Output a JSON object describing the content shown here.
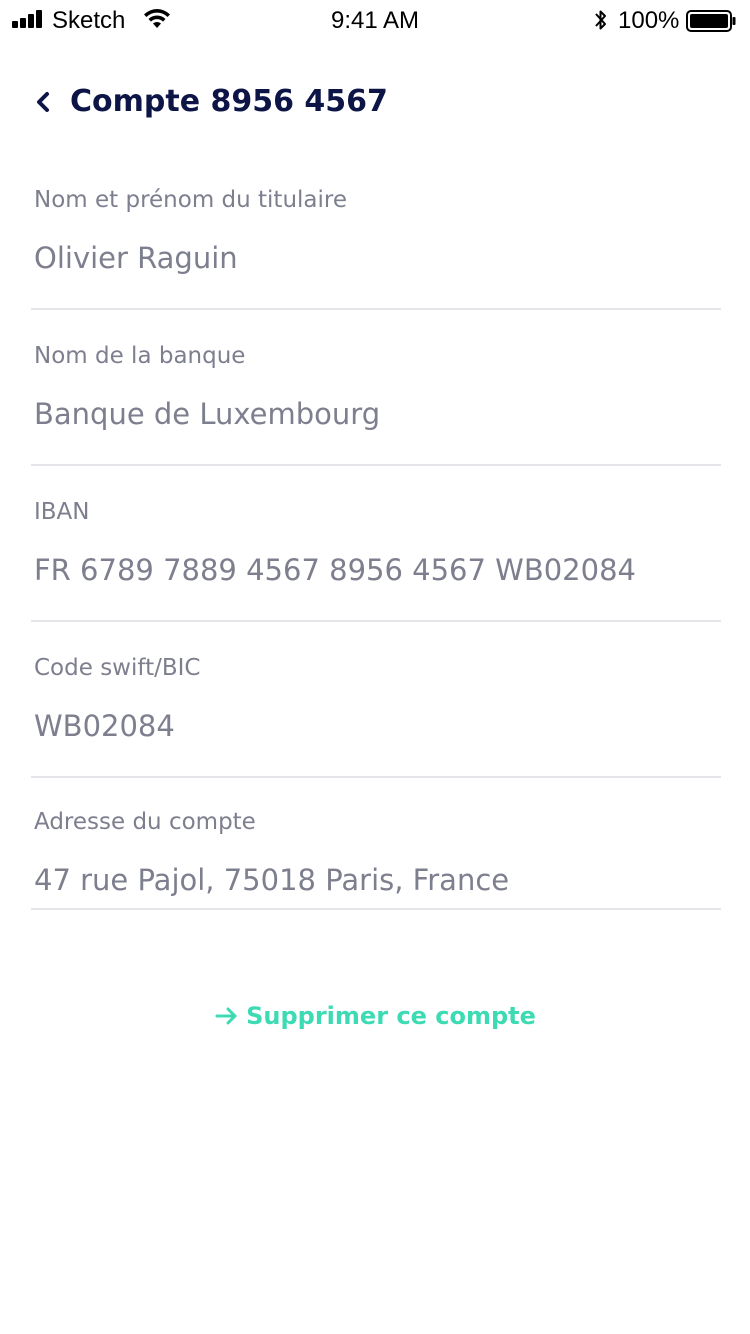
{
  "status_bar": {
    "carrier": "Sketch",
    "time": "9:41 AM",
    "battery_percent": "100%",
    "icons": [
      "signal-icon",
      "wifi-icon",
      "bluetooth-icon",
      "battery-icon"
    ]
  },
  "header": {
    "title": "Compte 8956 4567",
    "back_icon": "chevron-left-icon",
    "title_color": "#0d1547"
  },
  "fields": [
    {
      "label": "Nom et prénom du titulaire",
      "value": "Olivier Raguin"
    },
    {
      "label": "Nom de la banque",
      "value": "Banque de Luxembourg"
    },
    {
      "label": "IBAN",
      "value": "FR 6789 7889 4567 8956 4567 WB02084"
    },
    {
      "label": "Code swift/BIC",
      "value": "WB02084"
    },
    {
      "label": "Adresse du compte",
      "value": "47 rue Pajol, 75018 Paris, France"
    }
  ],
  "actions": {
    "delete_label": "Supprimer ce compte",
    "delete_icon": "arrow-right-icon",
    "accent_color": "#3ddbb3"
  },
  "colors": {
    "text_muted": "#7d7f8e",
    "divider": "#e6e6ea"
  }
}
